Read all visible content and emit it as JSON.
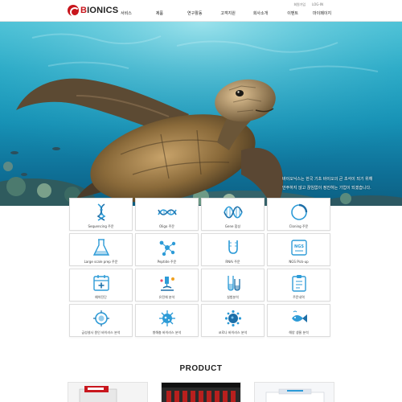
{
  "brand": {
    "name_first": "B",
    "name_rest": "IONICS"
  },
  "util_links": [
    "회원가입",
    "LOG-IN"
  ],
  "nav": [
    "서비스",
    "제품",
    "연구활동",
    "고객지원",
    "회사소개",
    "이벤트",
    "마이페이지"
  ],
  "hero": {
    "line1": "바이오닉스는 한국 기초 바이오의 큰 초석이 되기 위해",
    "line2": "안주하지 않고 끊임없이 정진하는 기업이 되겠습니다."
  },
  "services": [
    {
      "label": "Sequencing 주문",
      "icon": "dna-helix-icon"
    },
    {
      "label": "Oligo 주문",
      "icon": "oligo-strand-icon"
    },
    {
      "label": "Gene 합성",
      "icon": "gene-synthesis-icon"
    },
    {
      "label": "Cloning 주문",
      "icon": "cloning-ring-icon"
    },
    {
      "label": "Large scale prep 주문",
      "icon": "flask-icon"
    },
    {
      "label": "Peptide 주문",
      "icon": "peptide-molecule-icon"
    },
    {
      "label": "RNAi 주문",
      "icon": "rnai-icon"
    },
    {
      "label": "NGS Pick-up",
      "icon": "ngs-tube-icon"
    },
    {
      "label": "예약진단",
      "icon": "calendar-icon"
    },
    {
      "label": "유전체 분석",
      "icon": "microscope-icon"
    },
    {
      "label": "실험분석",
      "icon": "test-tubes-icon"
    },
    {
      "label": "주문내역",
      "icon": "clipboard-icon"
    },
    {
      "label": "급성설사 원인 바이러스 분석",
      "icon": "rotavirus-icon"
    },
    {
      "label": "병해충 바이러스 분석",
      "icon": "virus-icon"
    },
    {
      "label": "코로나 바이러스 분석",
      "icon": "coronavirus-icon"
    },
    {
      "label": "해양 생물 분석",
      "icon": "fish-icon"
    }
  ],
  "product_title": "PRODUCT",
  "colors": {
    "brand_red": "#c8161d",
    "icon_blue": "#2d9bd7",
    "sea": "#1690b4"
  }
}
